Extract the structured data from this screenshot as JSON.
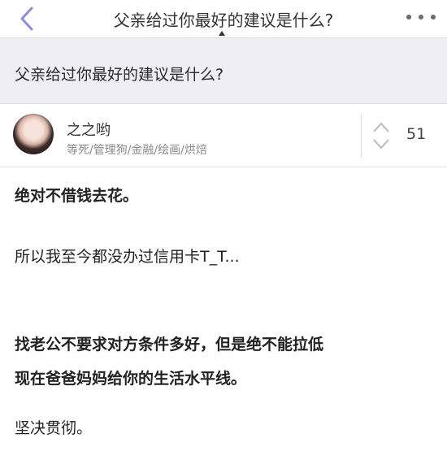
{
  "nav": {
    "title": "父亲给过你最好的建议是什么?"
  },
  "question": {
    "title": "父亲给过你最好的建议是什么?"
  },
  "answer": {
    "author": {
      "name": "之之哟",
      "tags": "等死/管理狗/金融/绘画/烘焙"
    },
    "votes": "51",
    "paragraphs": [
      "绝对不借钱去花。",
      "所以我至今都没办过信用卡T_T...",
      "找老公不要求对方条件多好，但是绝不能拉低",
      "现在爸爸妈妈给你的生活水平线。",
      "坚决贯彻。"
    ]
  },
  "icons": {
    "back": "chevron-left-icon",
    "more": "more-dots-icon",
    "vote": "vote-up-down-icon"
  },
  "colors": {
    "accent": "#8e8cd8",
    "question_bg": "#efeef4"
  }
}
